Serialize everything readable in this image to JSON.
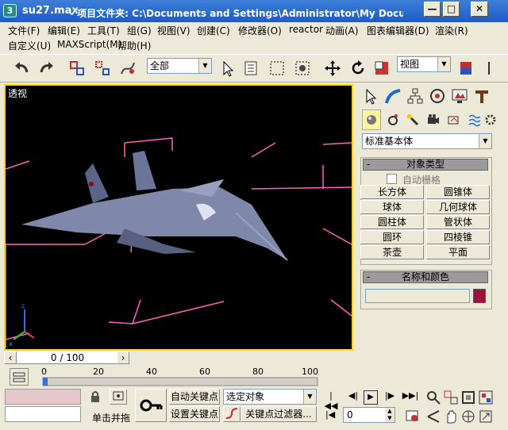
{
  "window": {
    "filename": "su27.max",
    "title_path": "- 项目文件夹: C:\\Documents and Settings\\Administrator\\My Document...",
    "minimize": "—",
    "restore": "□",
    "close": "✕",
    "app_icon": "3"
  },
  "menu": {
    "file": "文件(F)",
    "edit": "编辑(E)",
    "tools": "工具(T)",
    "group": "组(G)",
    "views": "视图(V)",
    "create": "创建(C)",
    "modifiers": "修改器(O)",
    "reactor": "reactor",
    "animation": "动画(A)",
    "graph_editors": "图表编辑器(D)",
    "rendering": "渲染(R)",
    "customize": "自定义(U)",
    "maxscript": "MAXScript(M)",
    "help": "帮助(H)"
  },
  "toolbar": {
    "selection_filter": "全部",
    "coord_system": "视图"
  },
  "viewport": {
    "label": "透视",
    "colors": {
      "bbox": "#ff60c0",
      "border": "#ffd700",
      "jet": "#8a93b5"
    }
  },
  "command_panel": {
    "category": "标准基本体",
    "object_type_title": "对象类型",
    "autogrid": "自动栅格",
    "buttons": [
      "长方体",
      "圆锥体",
      "球体",
      "几何球体",
      "圆柱体",
      "管状体",
      "圆环",
      "四棱锥",
      "茶壶",
      "平面"
    ],
    "name_color_title": "名称和颜色",
    "object_name": "",
    "object_color": "#a0103a"
  },
  "timeline": {
    "frame_display": "0 / 100",
    "ticks": [
      "0",
      "20",
      "40",
      "60",
      "80",
      "100"
    ]
  },
  "bottom": {
    "script_field_color": "#e6c8cc",
    "click_drag": "单击并拖",
    "auto_key": "自动关键点",
    "set_key": "设置关键点",
    "key_selected": "选定对象",
    "key_filters": "关键点过滤器...",
    "current_frame": "0"
  }
}
